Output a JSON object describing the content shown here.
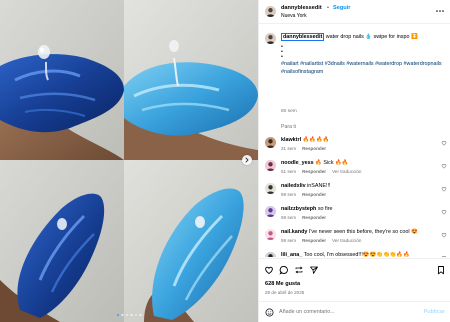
{
  "header": {
    "username": "dannyblessedit",
    "separator": "•",
    "follow_label": "Seguir",
    "location": "Nueva York",
    "more_icon": "more-horizontal-icon"
  },
  "media": {
    "carousel_next_icon": "chevron-right-icon",
    "slide_count": 6,
    "active_slide": 1
  },
  "caption": {
    "username": "dannyblessedit",
    "text": " water drop nails 💧 swipe for inspo ⏬",
    "bullets": [
      "•",
      "•",
      "•"
    ],
    "hashtags": "#nailart #nailartist #3dnails #waternails #waterdrop #waterdropnails #nailsofinstagram",
    "time": "60 sem"
  },
  "translate_label": "Para ti",
  "comments": [
    {
      "user": "klawktrl",
      "text": " 🔥🔥🔥🔥",
      "time": "31 sem",
      "reply": "Responder",
      "translate": ""
    },
    {
      "user": "noodle_yess",
      "text": " 🔥 Sick 🔥🔥",
      "time": "51 sem",
      "reply": "Responder",
      "translate": "Ver traducción"
    },
    {
      "user": "nailedxliv",
      "text": " inSANE!!!",
      "time": "59 sem",
      "reply": "Responder",
      "translate": ""
    },
    {
      "user": "nailzzbysteph",
      "text": " so fire",
      "time": "59 sem",
      "reply": "Responder",
      "translate": ""
    },
    {
      "user": "nail.kandy",
      "text": " I've never seen this before, they're so cool 😍",
      "time": "59 sem",
      "reply": "Responder",
      "translate": "Ver traducción"
    },
    {
      "user": "lili_ana_",
      "text": " Too cool, I'm obsessed!!!😍😍👏👏👏🔥🔥",
      "time": "59 sem",
      "reply": "Responder",
      "translate": "Ver traducción"
    }
  ],
  "actions": {
    "likes": "628 Me gusta",
    "date": "26 de abril de 2025",
    "icons": [
      "heart-icon",
      "comment-icon",
      "repost-icon",
      "share-icon",
      "bookmark-icon"
    ]
  },
  "composer": {
    "placeholder": "Añade un comentario...",
    "value": "",
    "post_label": "Publicar",
    "emoji_icon": "emoji-icon"
  },
  "colors": {
    "accent": "#0095f6",
    "hashtag": "#00376b",
    "muted": "#737373",
    "nail_dark_blue": "#1f4fa8",
    "nail_light_blue": "#4fb3e8"
  }
}
